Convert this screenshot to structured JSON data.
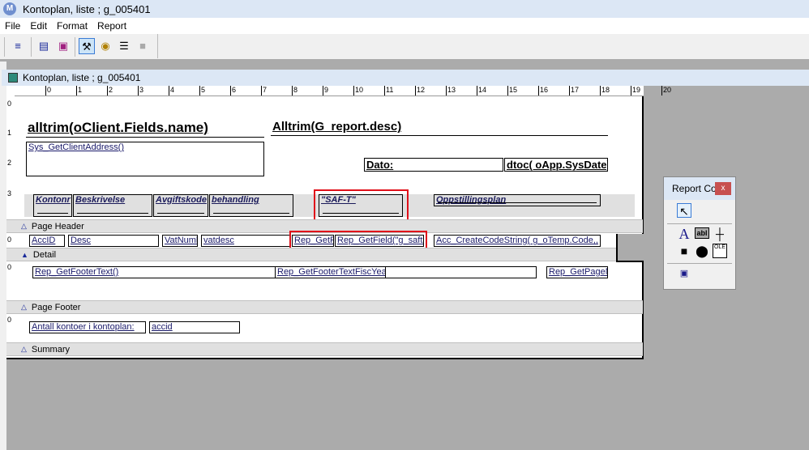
{
  "window": {
    "title": "Kontoplan, liste ; g_005401",
    "logo": "M"
  },
  "menu": [
    "File",
    "Edit",
    "Format",
    "Report"
  ],
  "toolbar": {
    "icons": [
      "tab-order-icon",
      "field-list-icon",
      "page-icon",
      "design-tools-icon",
      "palette-color-icon",
      "align-icon",
      "disabled-tool-icon"
    ]
  },
  "document": {
    "title": "Kontoplan, liste ; g_005401"
  },
  "ruler": {
    "top": [
      "0",
      "1",
      "2",
      "3",
      "4",
      "5",
      "6",
      "7",
      "8",
      "9",
      "10",
      "11",
      "12",
      "13",
      "14",
      "15",
      "16",
      "17",
      "18",
      "19",
      "20"
    ],
    "left": [
      "0",
      "1",
      "2",
      "3"
    ],
    "band_marks": [
      "0",
      "0",
      "0"
    ]
  },
  "title_fields": {
    "client_name": "alltrim(oClient.Fields.name)",
    "report_desc": "Alltrim(G_report.desc)",
    "client_address": "Sys_GetClientAddress()",
    "date_label": "Dato:",
    "date_value": "dtoc( oApp.SysDate)"
  },
  "column_headers": [
    "Kontonr",
    "Beskrivelse",
    "Avgiftskode",
    "behandling",
    "\"SAF-T\"",
    "Oppstillingsplan"
  ],
  "bands": {
    "page_header": "Page Header",
    "detail": "Detail",
    "page_footer": "Page Footer",
    "summary": "Summary"
  },
  "detail_fields": [
    "AccID",
    "Desc",
    "VatNumb",
    "vatdesc",
    "Rep_GetFi",
    "Rep_GetField(\"g_safta",
    "Acc_CreateCodeString( g_oTemp.Code,,"
  ],
  "footer_fields": [
    "Rep_GetFooterText()",
    "Rep_GetFooterTextFiscYea",
    "",
    "Rep_GetPageN"
  ],
  "summary_fields": {
    "label": "Antall kontoer i kontoplan:",
    "value": "accid"
  },
  "palette": {
    "title": "Report Co",
    "close": "x",
    "tools": [
      "pointer-icon",
      "label-tool-icon",
      "field-tool-icon",
      "line-tool-icon",
      "rectangle-tool-icon",
      "ellipse-tool-icon",
      "ole-tool-icon",
      "lock-icon"
    ]
  }
}
